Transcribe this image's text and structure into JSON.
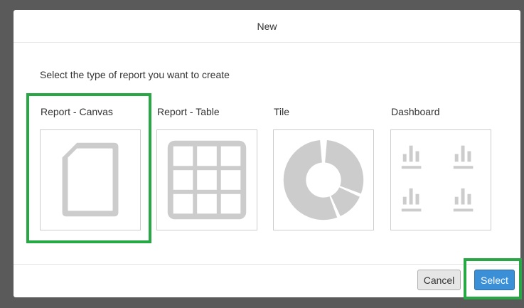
{
  "dialog": {
    "title": "New",
    "prompt": "Select the type of report you want to create",
    "selected_option": "Report - Canvas"
  },
  "options": [
    {
      "label": "Report - Canvas",
      "icon": "document-icon"
    },
    {
      "label": "Report - Table",
      "icon": "table-grid-icon"
    },
    {
      "label": "Tile",
      "icon": "donut-chart-icon"
    },
    {
      "label": "Dashboard",
      "icon": "dashboard-bars-icon"
    }
  ],
  "footer": {
    "cancel_label": "Cancel",
    "select_label": "Select"
  },
  "colors": {
    "highlight": "#27a844",
    "primary_button": "#3a8fd6",
    "icon_gray": "#cccccc"
  }
}
